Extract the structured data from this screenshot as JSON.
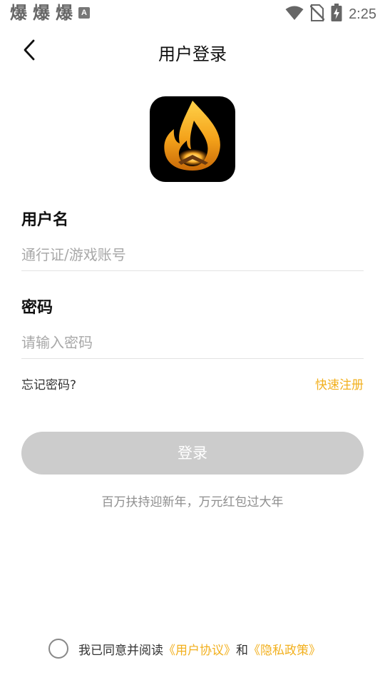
{
  "status_bar": {
    "notif_glyphs": [
      "爆",
      "爆",
      "爆"
    ],
    "notif_badge": "A",
    "time": "2:25"
  },
  "header": {
    "title": "用户登录"
  },
  "form": {
    "username_label": "用户名",
    "username_placeholder": "通行证/游戏账号",
    "username_value": "",
    "password_label": "密码",
    "password_placeholder": "请输入密码",
    "password_value": "",
    "forgot_password": "忘记密码?",
    "quick_register": "快速注册",
    "login_button": "登录"
  },
  "promo": "百万扶持迎新年，万元红包过大年",
  "agreement": {
    "prefix": "我已同意并阅读",
    "user_agreement": "《用户协议》",
    "conjunction": "和",
    "privacy_policy": "《隐私政策》",
    "checked": false
  },
  "colors": {
    "accent": "#f2b01e",
    "button_disabled": "#cccccc",
    "logo_bg": "#000000"
  },
  "icons": [
    "back-arrow-icon",
    "wifi-icon",
    "no-sim-icon",
    "battery-charging-icon",
    "flame-logo-icon"
  ]
}
